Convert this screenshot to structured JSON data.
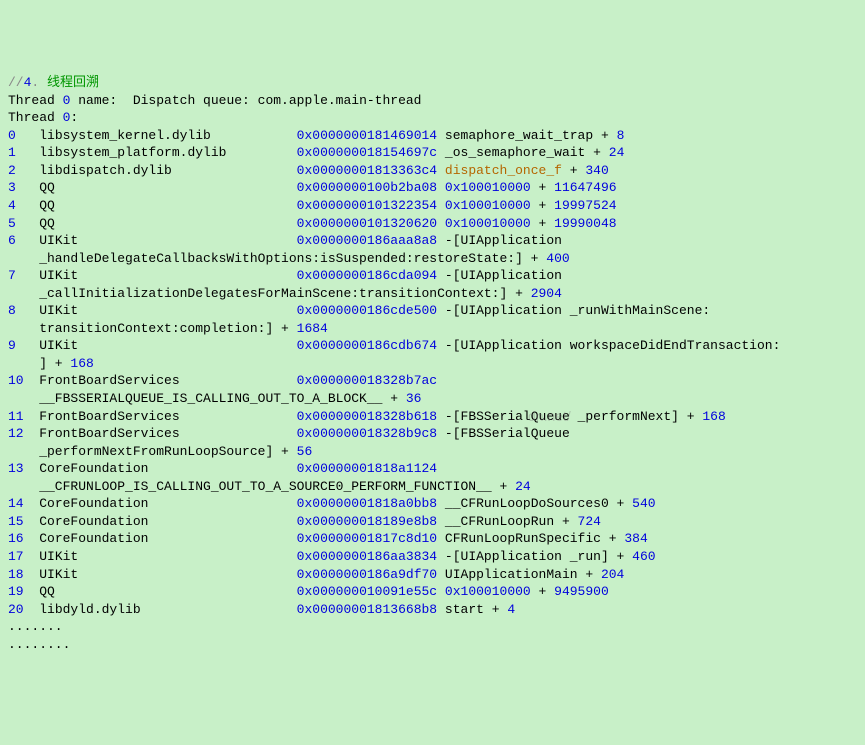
{
  "header": {
    "comment_prefix": "//",
    "section_number": "4",
    "section_title": "线程回溯",
    "thread_line1_a": "Thread",
    "thread_line1_num": "0",
    "thread_line1_b": "name:  Dispatch queue: com.apple.main-thread",
    "thread_line2_a": "Thread",
    "thread_line2_num": "0",
    "thread_line2_colon": ":"
  },
  "frames": [
    {
      "idx": "0",
      "lib": "libsystem_kernel.dylib",
      "addr": "0x0000000181469014",
      "sym": "semaphore_wait_trap",
      "off": "8"
    },
    {
      "idx": "1",
      "lib": "libsystem_platform.dylib",
      "addr": "0x000000018154697c",
      "sym": "_os_semaphore_wait",
      "off": "24"
    },
    {
      "idx": "2",
      "lib": "libdispatch.dylib",
      "addr": "0x00000001813363c4",
      "sym": "dispatch_once_f",
      "off": "340",
      "sym_style": "orange"
    },
    {
      "idx": "3",
      "lib": "QQ",
      "addr": "0x0000000100b2ba08",
      "base": "0x100010000",
      "off": "11647496"
    },
    {
      "idx": "4",
      "lib": "QQ",
      "addr": "0x0000000101322354",
      "base": "0x100010000",
      "off": "19997524"
    },
    {
      "idx": "5",
      "lib": "QQ",
      "addr": "0x0000000101320620",
      "base": "0x100010000",
      "off": "19990048"
    },
    {
      "idx": "6",
      "lib": "UIKit",
      "addr": "0x0000000186aaa8a8",
      "sym": "-[UIApplication",
      "cont": "_handleDelegateCallbacksWithOptions:isSuspended:restoreState:]",
      "off": "400"
    },
    {
      "idx": "7",
      "lib": "UIKit",
      "addr": "0x0000000186cda094",
      "sym": "-[UIApplication",
      "cont": "_callInitializationDelegatesForMainScene:transitionContext:]",
      "off": "2904"
    },
    {
      "idx": "8",
      "lib": "UIKit",
      "addr": "0x0000000186cde500",
      "sym": "-[UIApplication _runWithMainScene:",
      "cont": "transitionContext:completion:]",
      "off": "1684"
    },
    {
      "idx": "9",
      "lib": "UIKit",
      "addr": "0x0000000186cdb674",
      "sym": "-[UIApplication workspaceDidEndTransaction:",
      "cont": "]",
      "off": "168"
    },
    {
      "idx": "10",
      "lib": "FrontBoardServices",
      "addr": "0x000000018328b7ac",
      "cont": "__FBSSERIALQUEUE_IS_CALLING_OUT_TO_A_BLOCK__",
      "off": "36"
    },
    {
      "idx": "11",
      "lib": "FrontBoardServices",
      "addr": "0x000000018328b618",
      "sym": "-[FBSSerialQueue _performNext]",
      "off": "168"
    },
    {
      "idx": "12",
      "lib": "FrontBoardServices",
      "addr": "0x000000018328b9c8",
      "sym": "-[FBSSerialQueue",
      "cont": "_performNextFromRunLoopSource]",
      "off": "56"
    },
    {
      "idx": "13",
      "lib": "CoreFoundation",
      "addr": "0x00000001818a1124",
      "cont": "__CFRUNLOOP_IS_CALLING_OUT_TO_A_SOURCE0_PERFORM_FUNCTION__",
      "off": "24"
    },
    {
      "idx": "14",
      "lib": "CoreFoundation",
      "addr": "0x00000001818a0bb8",
      "sym": "__CFRunLoopDoSources0",
      "off": "540"
    },
    {
      "idx": "15",
      "lib": "CoreFoundation",
      "addr": "0x000000018189e8b8",
      "sym": "__CFRunLoopRun",
      "off": "724"
    },
    {
      "idx": "16",
      "lib": "CoreFoundation",
      "addr": "0x00000001817c8d10",
      "sym": "CFRunLoopRunSpecific",
      "off": "384"
    },
    {
      "idx": "17",
      "lib": "UIKit",
      "addr": "0x0000000186aa3834",
      "sym": "-[UIApplication _run]",
      "off": "460"
    },
    {
      "idx": "18",
      "lib": "UIKit",
      "addr": "0x0000000186a9df70",
      "sym": "UIApplicationMain",
      "off": "204"
    },
    {
      "idx": "19",
      "lib": "QQ",
      "addr": "0x000000010091e55c",
      "base": "0x100010000",
      "off": "9495900"
    },
    {
      "idx": "20",
      "lib": "libdyld.dylib",
      "addr": "0x00000001813668b8",
      "sym": "start",
      "off": "4"
    }
  ],
  "footer": {
    "dots1": ".......",
    "dots2": "........"
  },
  "plus": "+",
  "dot": ". ",
  "watermark": "dn.net/"
}
